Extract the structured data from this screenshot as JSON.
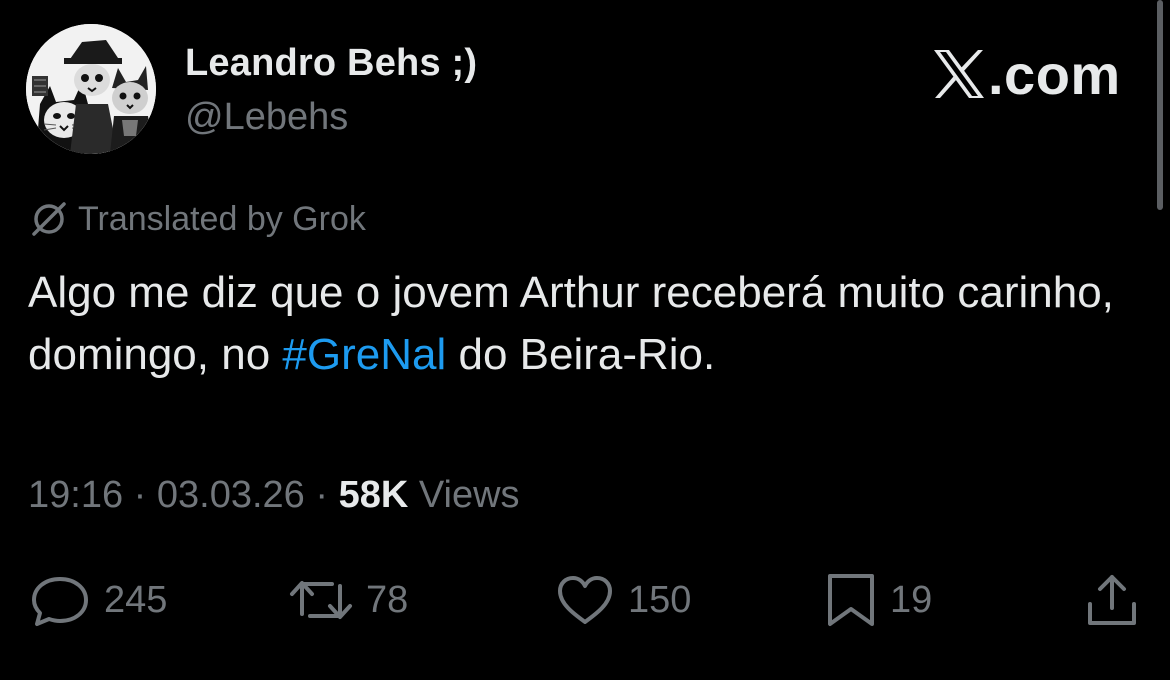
{
  "author": {
    "display_name": "Leandro Behs ;)",
    "handle": "@Lebehs",
    "avatar_icon": "cats-illustration-avatar"
  },
  "brand": {
    "text": ".com",
    "icon": "x-logo-icon"
  },
  "translation": {
    "label": "Translated by Grok",
    "icon": "grok-icon"
  },
  "tweet": {
    "text_before": "Algo me diz que o jovem Arthur receberá muito carinho, domingo, no ",
    "hashtag": "#GreNal",
    "text_after": " do Beira-Rio."
  },
  "meta": {
    "time": "19:16",
    "separator": " · ",
    "date": "03.03.26",
    "views_count": "58K",
    "views_label": " Views"
  },
  "actions": {
    "replies": "245",
    "reposts": "78",
    "likes": "150",
    "bookmarks": "19"
  },
  "colors": {
    "background": "#000000",
    "primary_text": "#e7e9ea",
    "secondary_text": "#71767b",
    "link": "#1d9bf0"
  }
}
